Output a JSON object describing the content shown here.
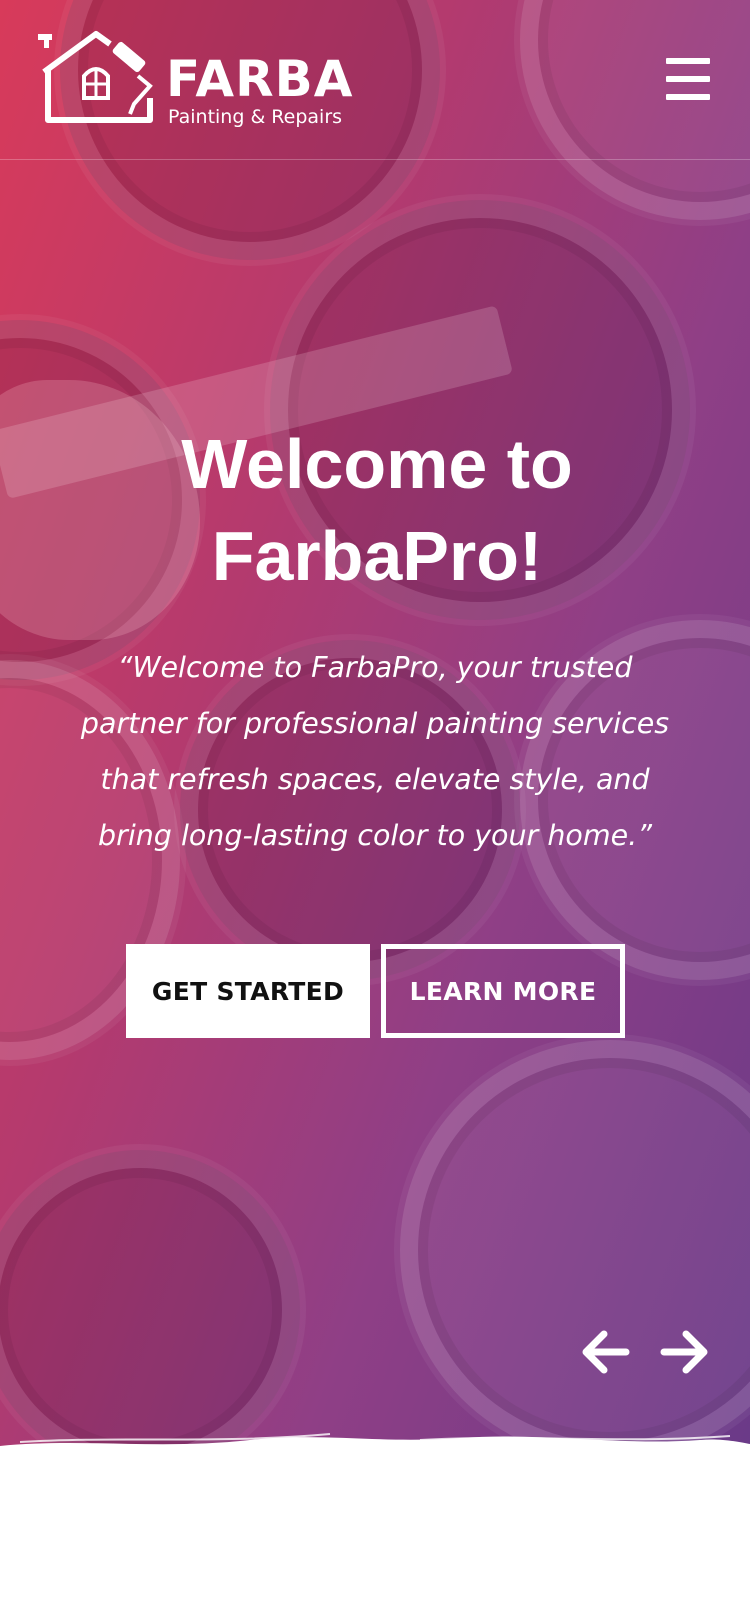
{
  "header": {
    "brand_name": "FARBA",
    "tagline": "Painting & Repairs",
    "logo_icon": "house-roller-icon",
    "menu_icon": "hamburger-menu-icon"
  },
  "hero": {
    "title_line1": "Welcome to",
    "title_line2": "FarbaPro!",
    "quote_line1": "“Welcome to FarbaPro, your trusted",
    "quote_line2": "partner for professional painting services",
    "quote_line3": "that refresh spaces, elevate style, and",
    "quote_line4": "bring long-lasting color to your home.”",
    "primary_button": "GET STARTED",
    "secondary_button": "LEARN MORE",
    "prev_icon": "arrow-left-icon",
    "next_icon": "arrow-right-icon"
  },
  "colors": {
    "gradient_start": "#d83a5a",
    "gradient_end": "#6a3a88",
    "text": "#ffffff",
    "button_text_dark": "#111111"
  }
}
